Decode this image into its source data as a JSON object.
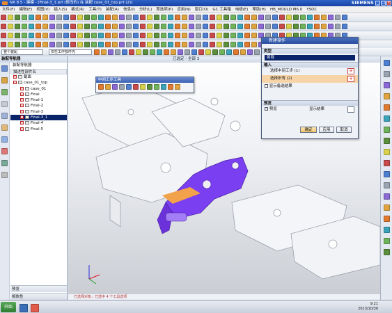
{
  "window": {
    "title": "NX 8.5 - 建模 - [Final-3_1.prt (修改的) 在 装配 case_01_top.prt (2)]",
    "brand": "SIEMENS"
  },
  "menu": [
    "文件(F)",
    "编辑(E)",
    "视图(V)",
    "插入(S)",
    "格式(R)",
    "工具(T)",
    "装配(A)",
    "信息(I)",
    "分析(L)",
    "首选项(P)",
    "应用(N)",
    "窗口(O)",
    "GC 工具箱",
    "电极(E)",
    "帮助(H)",
    "HB_MOULD M6.0",
    "YSOC"
  ],
  "toolbar": {
    "filter_value": "整个装配",
    "selection_value": "仅在工作部件内"
  },
  "navigator": {
    "title": "装配导航器",
    "panel_label": "装配导航器",
    "column_header": "描述性部件名",
    "tree": [
      {
        "label": "截面",
        "level": 0
      },
      {
        "label": "case_01_top",
        "level": 0
      },
      {
        "label": "case_01",
        "level": 1
      },
      {
        "label": "Final",
        "level": 1
      },
      {
        "label": "Final-1",
        "level": 1
      },
      {
        "label": "Final-2",
        "level": 1
      },
      {
        "label": "Final-3",
        "level": 1
      },
      {
        "label": "Final-3_1",
        "level": 1,
        "selected": true
      },
      {
        "label": "Final-4",
        "level": 1
      },
      {
        "label": "Final-5",
        "level": 1
      }
    ],
    "preview_label": "预览",
    "dependency_label": "相依性"
  },
  "viewport": {
    "status_text": "已选定 - 全部 3"
  },
  "float_toolbar": {
    "title": "中间工步工具"
  },
  "dialog": {
    "title": "新建操作",
    "type_section": "类型",
    "type_value": "剪裁",
    "input_section": "输入",
    "select_intermediate": "选择中间工步 (1)",
    "select_edge": "选择折弯 (2)",
    "show_alternatives": "显示备选结果",
    "preview_section": "预览",
    "preview_check": "预览",
    "show_result": "显示结果",
    "ok": "确定",
    "apply": "应用",
    "cancel": "取消"
  },
  "status_bar": "已选择对象，已选中 4 个工具选项",
  "taskbar": {
    "start": "开始",
    "time": "9:21",
    "date": "2013/10/30"
  },
  "colors": {
    "part_purple": "#7a3ff0",
    "highlight_orange": "#f2a24a",
    "title_blue": "#1f4fb6"
  }
}
